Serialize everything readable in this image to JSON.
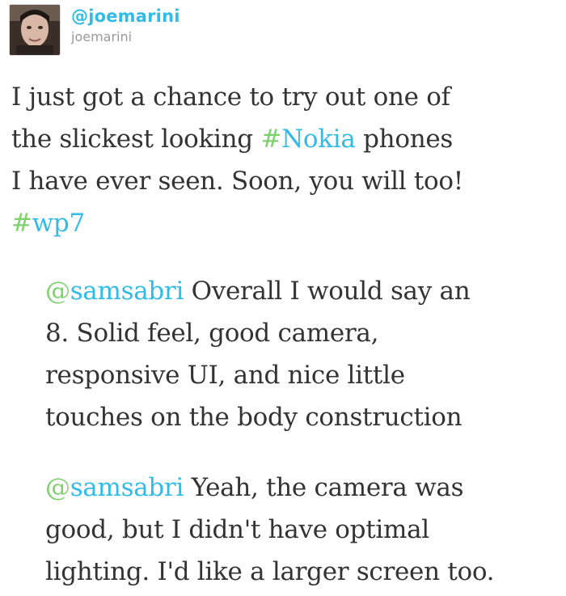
{
  "user": {
    "screen_name": "@joemarini",
    "name": "joemarini",
    "avatar_icon": "user-avatar"
  },
  "colors": {
    "link": "#33bbe8",
    "symbol": "#7fd06e",
    "text": "#333333",
    "muted": "#9a9a9a"
  },
  "tweet": {
    "line1": "I just got a chance to try out one of",
    "line2_pre": "the slickest looking ",
    "hashtag1_sym": "#",
    "hashtag1_text": "Nokia",
    "line2_post": " phones",
    "line3": "I have ever seen. Soon, you will too!",
    "hashtag2_sym": "#",
    "hashtag2_text": "wp7"
  },
  "replies": [
    {
      "mention_sym": "@",
      "mention_text": "samsabri",
      "line1": " Overall I would say an",
      "line2": "8. Solid feel, good camera,",
      "line3": "responsive UI, and nice little",
      "line4": "touches on the body construction"
    },
    {
      "mention_sym": "@",
      "mention_text": "samsabri",
      "line1": " Yeah, the camera was",
      "line2": "good, but I didn't have optimal",
      "line3": "lighting. I'd like a larger screen too."
    }
  ]
}
